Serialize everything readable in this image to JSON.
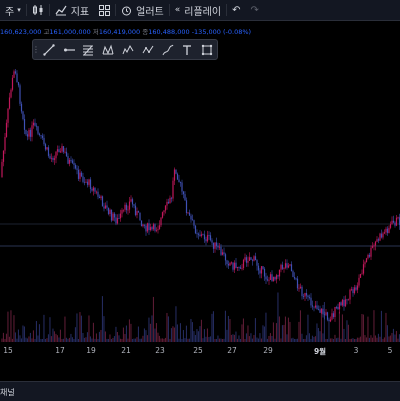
{
  "toolbar": {
    "interval_label": "주",
    "indicators_label": "지표",
    "alert_label": "얼러트",
    "replay_label": "리플레이"
  },
  "ohlc": {
    "open": "160,623,000",
    "high_label": "고",
    "high": "161,000,000",
    "low_label": "저",
    "low": "160,419,000",
    "close_label": "종",
    "close": "160,488,000",
    "change": "-135,000 (-0.08%)"
  },
  "drawing_tools": [
    "trend-line-icon",
    "horizontal-ray-icon",
    "fib-retracement-icon",
    "pattern-icon",
    "elliott-wave-icon",
    "projection-icon",
    "brush-icon",
    "text-icon",
    "measure-icon"
  ],
  "x_axis": {
    "labels": [
      "15",
      "17",
      "19",
      "21",
      "23",
      "25",
      "27",
      "29",
      "9월",
      "3",
      "5"
    ]
  },
  "bottom_panel": {
    "label": "채널"
  },
  "colors": {
    "up": "#c2185b",
    "down": "#3f51b5",
    "volume_up": "#5a1b33",
    "volume_down": "#232a5c",
    "background": "#000000",
    "toolbar": "#131722"
  },
  "chart_data": {
    "type": "candlestick",
    "price_path": [
      150,
      250,
      330,
      450,
      530,
      630,
      700,
      760
    ],
    "price_path_series": [
      [
        0,
        0.55
      ],
      [
        3,
        0.7
      ],
      [
        6,
        0.88
      ],
      [
        9,
        0.98
      ],
      [
        12,
        0.85
      ],
      [
        16,
        0.7
      ],
      [
        20,
        0.75
      ],
      [
        26,
        0.68
      ],
      [
        30,
        0.62
      ],
      [
        36,
        0.67
      ],
      [
        42,
        0.6
      ],
      [
        48,
        0.55
      ],
      [
        54,
        0.52
      ],
      [
        58,
        0.48
      ],
      [
        62,
        0.44
      ],
      [
        66,
        0.4
      ],
      [
        70,
        0.38
      ],
      [
        74,
        0.42
      ],
      [
        78,
        0.46
      ],
      [
        82,
        0.4
      ],
      [
        86,
        0.36
      ],
      [
        90,
        0.34
      ],
      [
        94,
        0.36
      ],
      [
        98,
        0.42
      ],
      [
        102,
        0.47
      ],
      [
        104,
        0.6
      ],
      [
        108,
        0.5
      ],
      [
        112,
        0.4
      ],
      [
        116,
        0.35
      ],
      [
        120,
        0.32
      ],
      [
        124,
        0.31
      ],
      [
        128,
        0.28
      ],
      [
        132,
        0.25
      ],
      [
        136,
        0.22
      ],
      [
        140,
        0.2
      ],
      [
        144,
        0.21
      ],
      [
        148,
        0.24
      ],
      [
        152,
        0.22
      ],
      [
        156,
        0.18
      ],
      [
        160,
        0.15
      ],
      [
        164,
        0.17
      ],
      [
        168,
        0.2
      ],
      [
        172,
        0.22
      ],
      [
        176,
        0.14
      ],
      [
        180,
        0.1
      ],
      [
        184,
        0.06
      ],
      [
        188,
        0.05
      ],
      [
        192,
        0.02
      ],
      [
        196,
        0.0
      ],
      [
        200,
        0.03
      ],
      [
        204,
        0.06
      ],
      [
        208,
        0.09
      ],
      [
        212,
        0.12
      ],
      [
        216,
        0.2
      ],
      [
        220,
        0.25
      ],
      [
        224,
        0.3
      ],
      [
        228,
        0.33
      ],
      [
        232,
        0.36
      ],
      [
        236,
        0.38
      ]
    ]
  }
}
